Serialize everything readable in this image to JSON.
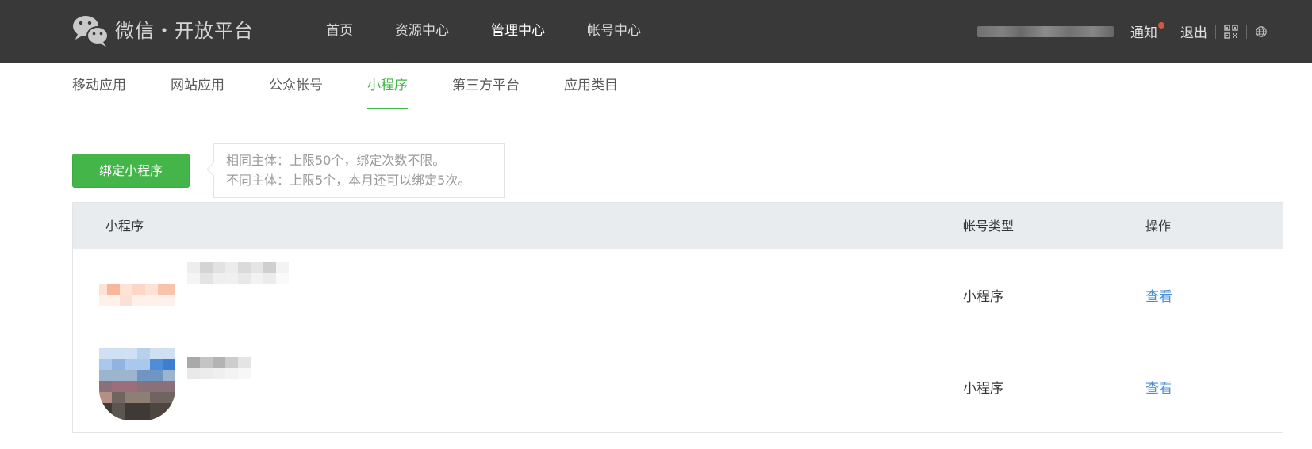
{
  "brand": {
    "name": "微信・开放平台"
  },
  "main_nav": [
    {
      "label": "首页",
      "active": false
    },
    {
      "label": "资源中心",
      "active": false
    },
    {
      "label": "管理中心",
      "active": true
    },
    {
      "label": "帐号中心",
      "active": false
    }
  ],
  "user_bar": {
    "notify_label": "通知",
    "logout_label": "退出",
    "qrcode_icon": "qrcode-icon",
    "language_icon": "globe-icon"
  },
  "sub_nav": [
    {
      "label": "移动应用",
      "active": false
    },
    {
      "label": "网站应用",
      "active": false
    },
    {
      "label": "公众帐号",
      "active": false
    },
    {
      "label": "小程序",
      "active": true
    },
    {
      "label": "第三方平台",
      "active": false
    },
    {
      "label": "应用类目",
      "active": false
    }
  ],
  "bind_button": {
    "label": "绑定小程序"
  },
  "tip": {
    "line1": "相同主体：上限50个，绑定次数不限。",
    "line2": "不同主体：上限5个，本月还可以绑定5次。"
  },
  "table": {
    "headers": {
      "name": "小程序",
      "type": "帐号类型",
      "action": "操作"
    },
    "rows": [
      {
        "type": "小程序",
        "action": "查看"
      },
      {
        "type": "小程序",
        "action": "查看"
      }
    ]
  },
  "colors": {
    "topbar_bg": "#393939",
    "accent_green": "#44b549",
    "link_blue": "#4a90d9",
    "notify_dot": "#d2593d",
    "table_header_bg": "#e9ecef"
  }
}
